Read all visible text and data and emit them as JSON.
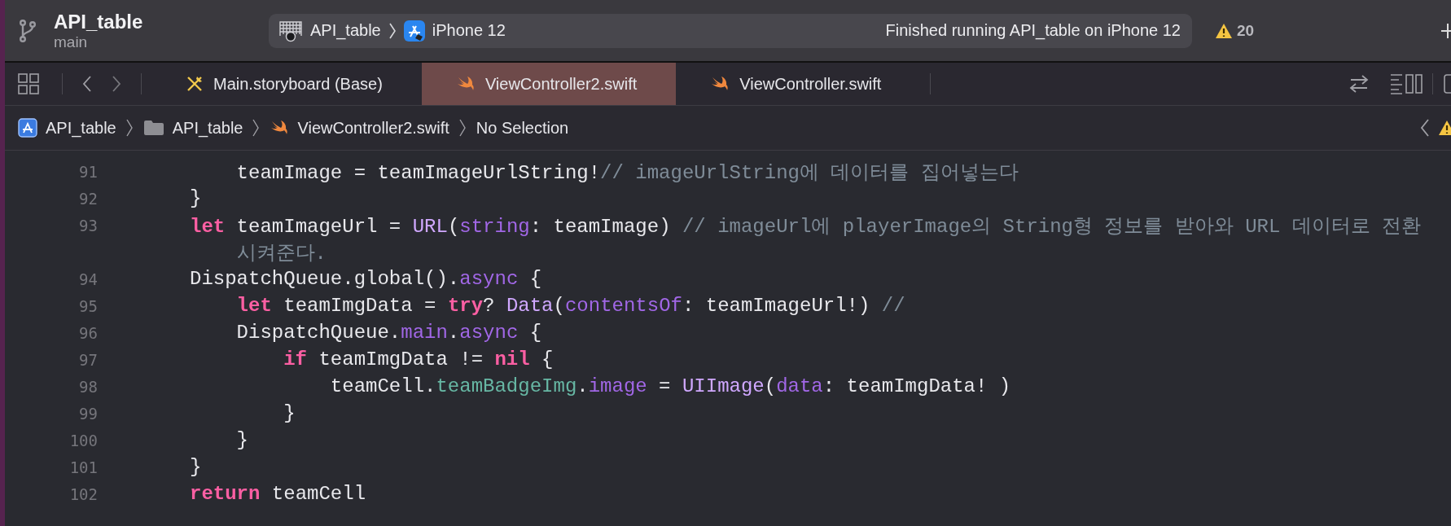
{
  "project": {
    "name": "API_table",
    "branch": "main"
  },
  "scheme": {
    "target": "API_table",
    "device": "iPhone 12",
    "status": "Finished running API_table on iPhone 12"
  },
  "warnings": {
    "count": "20"
  },
  "tabs": [
    {
      "label": "Main.storyboard (Base)",
      "kind": "storyboard",
      "selected": false
    },
    {
      "label": "ViewController2.swift",
      "kind": "swift",
      "selected": true
    },
    {
      "label": "ViewController.swift",
      "kind": "swift",
      "selected": false
    }
  ],
  "breadcrumb": [
    {
      "label": "API_table",
      "kind": "project"
    },
    {
      "label": "API_table",
      "kind": "folder"
    },
    {
      "label": "ViewController2.swift",
      "kind": "swift"
    },
    {
      "label": "No Selection",
      "kind": "text"
    }
  ],
  "code": {
    "lines": [
      {
        "number": "91",
        "tokens": [
          {
            "kind": "plain",
            "text": "    teamImage = teamImageUrlString!"
          },
          {
            "kind": "comment",
            "text": "// imageUrlString에 데이터를 집어넣는다"
          }
        ]
      },
      {
        "number": "92",
        "tokens": [
          {
            "kind": "plain",
            "text": "}"
          }
        ]
      },
      {
        "number": "93",
        "tokens": [
          {
            "kind": "keyword",
            "text": "let"
          },
          {
            "kind": "plain",
            "text": " teamImageUrl = "
          },
          {
            "kind": "type",
            "text": "URL"
          },
          {
            "kind": "plain",
            "text": "("
          },
          {
            "kind": "member",
            "text": "string"
          },
          {
            "kind": "plain",
            "text": ": teamImage) "
          },
          {
            "kind": "comment",
            "text": "// imageUrl에 playerImage의 String형 정보를 받아와 URL 데이터로 전환"
          }
        ],
        "wrap": [
          {
            "kind": "comment",
            "text": "시켜준다."
          }
        ]
      },
      {
        "number": "94",
        "tokens": [
          {
            "kind": "plain",
            "text": "DispatchQueue.global()."
          },
          {
            "kind": "member",
            "text": "async"
          },
          {
            "kind": "plain",
            "text": " {"
          }
        ]
      },
      {
        "number": "95",
        "tokens": [
          {
            "kind": "keyword",
            "text": "    let"
          },
          {
            "kind": "plain",
            "text": " teamImgData = "
          },
          {
            "kind": "keyword",
            "text": "try"
          },
          {
            "kind": "plain",
            "text": "? "
          },
          {
            "kind": "type",
            "text": "Data"
          },
          {
            "kind": "plain",
            "text": "("
          },
          {
            "kind": "member",
            "text": "contentsOf"
          },
          {
            "kind": "plain",
            "text": ": teamImageUrl!) "
          },
          {
            "kind": "comment",
            "text": "//"
          }
        ]
      },
      {
        "number": "96",
        "tokens": [
          {
            "kind": "plain",
            "text": "    DispatchQueue."
          },
          {
            "kind": "member",
            "text": "main"
          },
          {
            "kind": "plain",
            "text": "."
          },
          {
            "kind": "member",
            "text": "async"
          },
          {
            "kind": "plain",
            "text": " {"
          }
        ]
      },
      {
        "number": "97",
        "tokens": [
          {
            "kind": "keyword",
            "text": "        if"
          },
          {
            "kind": "plain",
            "text": " teamImgData != "
          },
          {
            "kind": "keyword",
            "text": "nil"
          },
          {
            "kind": "plain",
            "text": " {"
          }
        ]
      },
      {
        "number": "98",
        "tokens": [
          {
            "kind": "plain",
            "text": "            teamCell."
          },
          {
            "kind": "project",
            "text": "teamBadgeImg"
          },
          {
            "kind": "plain",
            "text": "."
          },
          {
            "kind": "member",
            "text": "image"
          },
          {
            "kind": "plain",
            "text": " = "
          },
          {
            "kind": "type",
            "text": "UIImage"
          },
          {
            "kind": "plain",
            "text": "("
          },
          {
            "kind": "member",
            "text": "data"
          },
          {
            "kind": "plain",
            "text": ": teamImgData! )"
          }
        ]
      },
      {
        "number": "99",
        "tokens": [
          {
            "kind": "plain",
            "text": "        }"
          }
        ]
      },
      {
        "number": "100",
        "tokens": [
          {
            "kind": "plain",
            "text": "    }"
          }
        ]
      },
      {
        "number": "101",
        "tokens": [
          {
            "kind": "plain",
            "text": "}"
          }
        ]
      },
      {
        "number": "102",
        "tokens": [
          {
            "kind": "keyword",
            "text": "return"
          },
          {
            "kind": "plain",
            "text": " teamCell"
          }
        ]
      }
    ]
  }
}
